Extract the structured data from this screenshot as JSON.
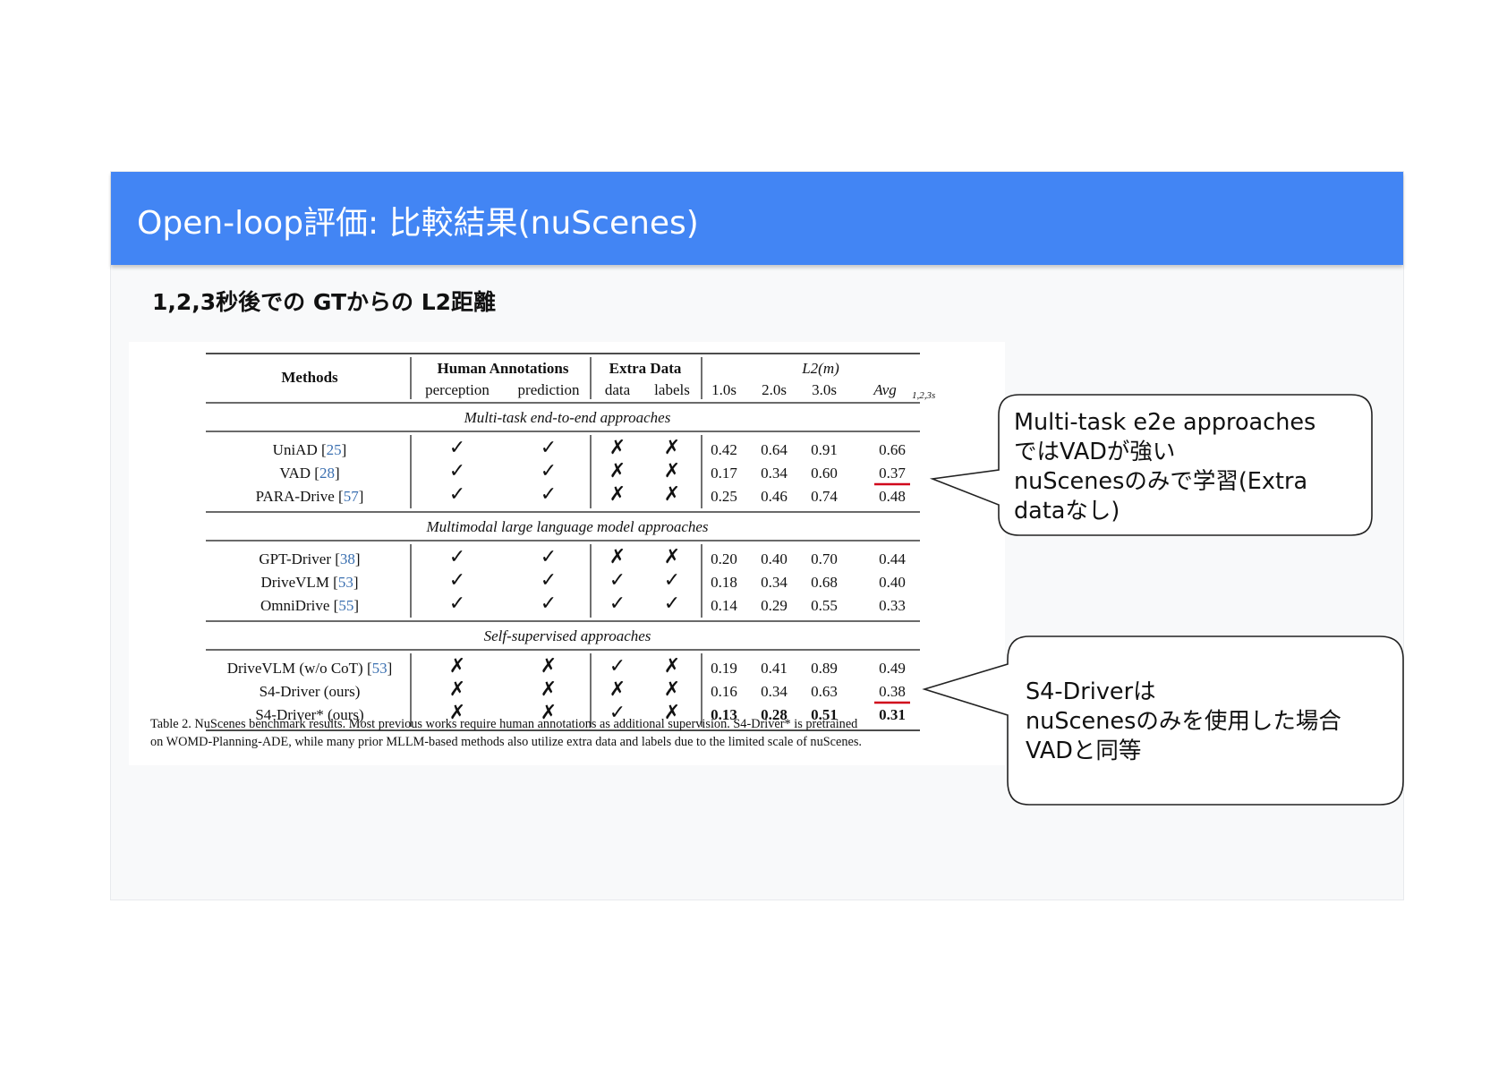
{
  "header": {
    "title": "Open-loop評価: 比較結果(nuScenes)"
  },
  "subtitle": "1,2,3秒後での GTからの L2距離",
  "table": {
    "col_methods": "Methods",
    "col_human": "Human Annotations",
    "col_perception": "perception",
    "col_prediction": "prediction",
    "col_extra": "Extra Data",
    "col_data": "data",
    "col_labels": "labels",
    "col_l2": "L2(m)",
    "col_t1": "1.0s",
    "col_t2": "2.0s",
    "col_t3": "3.0s",
    "col_avg": "Avg",
    "col_avg_sub": "1,2,3s",
    "groups": [
      {
        "title": "Multi-task end-to-end approaches",
        "rows": [
          {
            "method": "UniAD [25]",
            "name": "UniAD",
            "cite": "25",
            "perception": "✓",
            "prediction": "✓",
            "data": "✗",
            "labels": "✗",
            "t1": "0.42",
            "t2": "0.64",
            "t3": "0.91",
            "avg": "0.66"
          },
          {
            "method": "VAD [28]",
            "name": "VAD",
            "cite": "28",
            "perception": "✓",
            "prediction": "✓",
            "data": "✗",
            "labels": "✗",
            "t1": "0.17",
            "t2": "0.34",
            "t3": "0.60",
            "avg": "0.37"
          },
          {
            "method": "PARA-Drive [57]",
            "name": "PARA-Drive",
            "cite": "57",
            "perception": "✓",
            "prediction": "✓",
            "data": "✗",
            "labels": "✗",
            "t1": "0.25",
            "t2": "0.46",
            "t3": "0.74",
            "avg": "0.48"
          }
        ]
      },
      {
        "title": "Multimodal large language model approaches",
        "rows": [
          {
            "method": "GPT-Driver [38]",
            "name": "GPT-Driver",
            "cite": "38",
            "perception": "✓",
            "prediction": "✓",
            "data": "✗",
            "labels": "✗",
            "t1": "0.20",
            "t2": "0.40",
            "t3": "0.70",
            "avg": "0.44"
          },
          {
            "method": "DriveVLM [53]",
            "name": "DriveVLM",
            "cite": "53",
            "perception": "✓",
            "prediction": "✓",
            "data": "✓",
            "labels": "✓",
            "t1": "0.18",
            "t2": "0.34",
            "t3": "0.68",
            "avg": "0.40"
          },
          {
            "method": "OmniDrive [55]",
            "name": "OmniDrive",
            "cite": "55",
            "perception": "✓",
            "prediction": "✓",
            "data": "✓",
            "labels": "✓",
            "t1": "0.14",
            "t2": "0.29",
            "t3": "0.55",
            "avg": "0.33"
          }
        ]
      },
      {
        "title": "Self-supervised approaches",
        "rows": [
          {
            "method": "DriveVLM (w/o CoT) [53]",
            "name": "DriveVLM (w/o CoT)",
            "cite": "53",
            "perception": "✗",
            "prediction": "✗",
            "data": "✓",
            "labels": "✗",
            "t1": "0.19",
            "t2": "0.41",
            "t3": "0.89",
            "avg": "0.49"
          },
          {
            "method": "S4-Driver (ours)",
            "name": "S4-Driver (ours)",
            "cite": "",
            "perception": "✗",
            "prediction": "✗",
            "data": "✗",
            "labels": "✗",
            "t1": "0.16",
            "t2": "0.34",
            "t3": "0.63",
            "avg": "0.38"
          },
          {
            "method": "S4-Driver* (ours)",
            "name": "S4-Driver* (ours)",
            "cite": "",
            "perception": "✗",
            "prediction": "✗",
            "data": "✓",
            "labels": "✗",
            "t1": "0.13",
            "t2": "0.28",
            "t3": "0.51",
            "avg": "0.31",
            "bold": true
          }
        ]
      }
    ],
    "caption_line1": "Table 2. NuScenes benchmark results. Most previous works require human annotations as additional supervision. S4-Driver* is pretrained",
    "caption_line2": "on WOMD-Planning-ADE, while many prior MLLM-based methods also utilize extra data and labels due to the limited scale of nuScenes.",
    "underline_color": "#d0021b"
  },
  "callouts": [
    {
      "lines": [
        "Multi-task e2e approaches",
        "ではVADが強い",
        "nuScenesのみで学習(Extra",
        "dataなし)"
      ]
    },
    {
      "lines": [
        "S4-Driverは",
        "nuScenesのみを使用した場合",
        "VADと同等"
      ]
    }
  ],
  "colors": {
    "header": "#4285f4",
    "accent_underline": "#d0021b"
  }
}
